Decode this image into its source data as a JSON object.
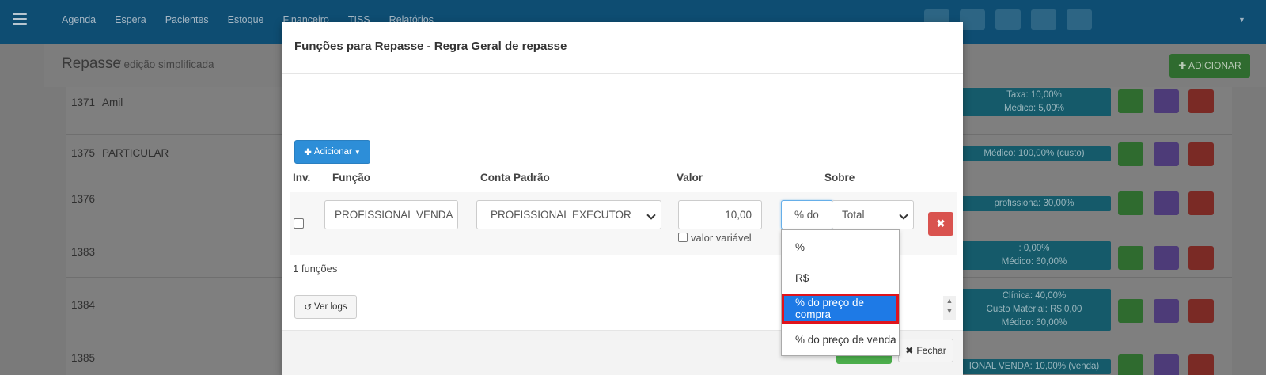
{
  "topnav": {
    "items": [
      "Agenda",
      "Espera",
      "Pacientes",
      "Estoque",
      "Financeiro",
      "TISS",
      "Relatórios"
    ]
  },
  "page": {
    "title": "Repasse",
    "breadcrumb_sep": "/",
    "breadcrumb": "/ edição simplificada",
    "add_button": "✚ ADICIONAR"
  },
  "background_rows": [
    {
      "id": "1371",
      "name": "Amil",
      "badge_lines": [
        "Taxa: 10,00%",
        "Médico: 5,00%"
      ]
    },
    {
      "id": "1375",
      "name": "PARTICULAR",
      "badge_lines": [
        "Médico: 100,00% (custo)"
      ]
    },
    {
      "id": "1376",
      "name": "",
      "badge_lines": [
        "profissiona: 30,00%"
      ]
    },
    {
      "id": "1383",
      "name": "",
      "badge_lines": [
        ": 0,00%",
        "Médico: 60,00%"
      ]
    },
    {
      "id": "1384",
      "name": "",
      "badge_lines": [
        "Clínica: 40,00%",
        "Custo Material: R$ 0,00",
        "Médico: 60,00%"
      ]
    },
    {
      "id": "1385",
      "name": "",
      "badge_lines": [
        "IONAL VENDA: 10,00% (venda)"
      ]
    }
  ],
  "modal": {
    "title": "Funções para Repasse - Regra Geral de repasse",
    "add_button": "Adicionar",
    "headers": {
      "inv": "Inv.",
      "funcao": "Função",
      "conta": "Conta Padrão",
      "valor": "Valor",
      "sobre": "Sobre"
    },
    "row": {
      "funcao": "PROFISSIONAL VENDA",
      "conta": "PROFISSIONAL EXECUTOR",
      "valor": "10,00",
      "valor_variavel_label": "valor variável",
      "tipo_short": "% do",
      "sobre": "Total"
    },
    "count": "1 funções",
    "logs_button": "Ver logs",
    "close_button": "Fechar"
  },
  "dropdown": {
    "options": [
      "%",
      "R$",
      "% do preço de compra",
      "% do preço de venda"
    ],
    "selected_index": 2
  },
  "colors": {
    "topbar": "#0e4d72",
    "primary": "#2d8ed8",
    "success": "#4cae4c",
    "danger": "#d9534f",
    "highlight_outline": "#e0131c"
  }
}
